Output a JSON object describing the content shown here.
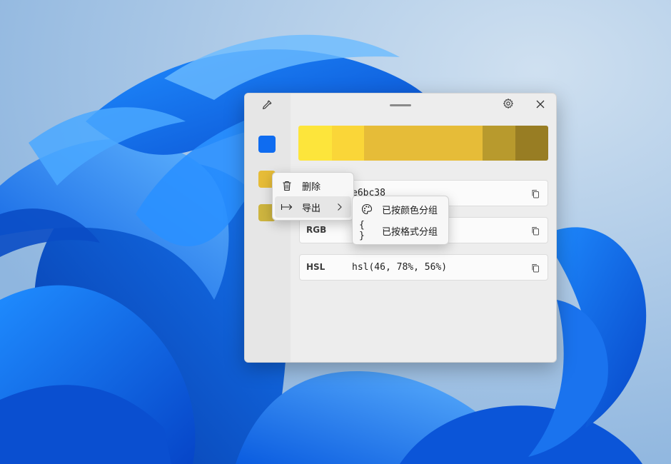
{
  "colors": {
    "selected_color": "#0f6cf0",
    "current_color": "#e6bc38",
    "palette": [
      "#fde53b",
      "#fad638",
      "#e6bc38",
      "#e6bc38",
      "#b89a2d",
      "#987d23"
    ],
    "history": [
      "#0f6cf0",
      "#e6bc38",
      "#cdb43f"
    ]
  },
  "window": {
    "icons": {
      "picker": "eyedropper-icon",
      "settings": "gear-icon",
      "close": "close-icon"
    }
  },
  "values": [
    {
      "label": "",
      "value": "e6bc38"
    },
    {
      "label": "RGB",
      "value": ""
    },
    {
      "label": "HSL",
      "value": "hsl(46, 78%, 56%)"
    }
  ],
  "context_menu": {
    "items": [
      {
        "label": "删除",
        "icon": "trash-icon"
      },
      {
        "label": "导出",
        "icon": "export-icon",
        "has_submenu": true
      }
    ]
  },
  "submenu": {
    "items": [
      {
        "label": "已按颜色分组",
        "icon": "palette-icon"
      },
      {
        "label": "已按格式分组",
        "icon": "braces-icon"
      }
    ]
  }
}
